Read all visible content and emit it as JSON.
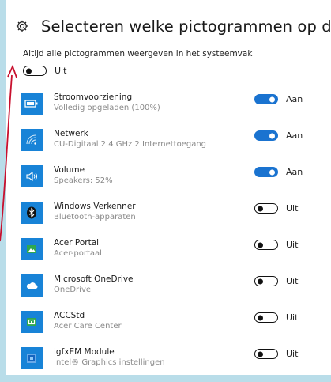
{
  "header": {
    "title": "Selecteren welke pictogrammen op de"
  },
  "always_show": {
    "label": "Altijd alle pictogrammen weergeven in het systeemvak",
    "state": "Uit"
  },
  "colors": {
    "accent": "#1a73d0",
    "tile": "#1883d7",
    "annotation_arrow": "#c8102e"
  },
  "items": [
    {
      "name": "Stroomvoorziening",
      "sub": "Volledig opgeladen (100%)",
      "state": "Aan",
      "on": true,
      "icon": "battery-icon"
    },
    {
      "name": "Netwerk",
      "sub": "CU-Digitaal 2.4 GHz  2 Internettoegang",
      "state": "Aan",
      "on": true,
      "icon": "wifi-icon"
    },
    {
      "name": "Volume",
      "sub": "Speakers: 52%",
      "state": "Aan",
      "on": true,
      "icon": "speaker-icon"
    },
    {
      "name": "Windows Verkenner",
      "sub": "Bluetooth-apparaten",
      "state": "Uit",
      "on": false,
      "icon": "bluetooth-icon"
    },
    {
      "name": "Acer Portal",
      "sub": "Acer-portaal",
      "state": "Uit",
      "on": false,
      "icon": "acer-portal-icon"
    },
    {
      "name": "Microsoft OneDrive",
      "sub": "OneDrive",
      "state": "Uit",
      "on": false,
      "icon": "onedrive-cloud-icon"
    },
    {
      "name": "ACCStd",
      "sub": "Acer Care Center",
      "state": "Uit",
      "on": false,
      "icon": "acer-care-icon"
    },
    {
      "name": "igfxEM Module",
      "sub": "Intel® Graphics instellingen",
      "state": "Uit",
      "on": false,
      "icon": "intel-graphics-icon"
    }
  ]
}
